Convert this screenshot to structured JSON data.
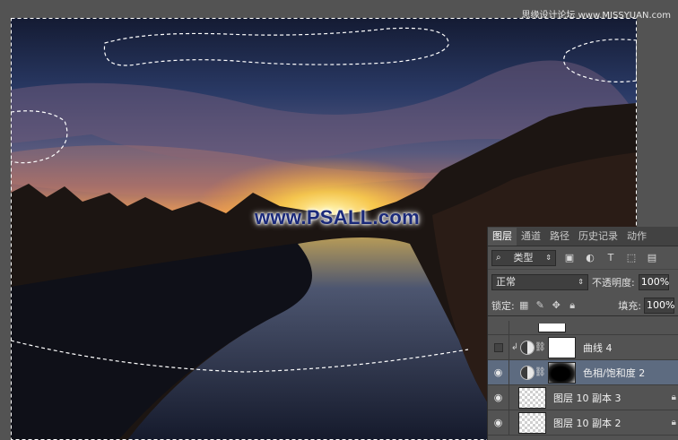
{
  "watermark": "思缘设计论坛 www.MISSYUAN.com",
  "canvas": {
    "site_label": "www.PSALL.com"
  },
  "panel": {
    "tabs": [
      "图层",
      "通道",
      "路径",
      "历史记录",
      "动作"
    ],
    "filter": {
      "kind": "类型",
      "icons": [
        "image-filter-icon",
        "adjustment-filter-icon",
        "type-filter-icon",
        "shape-filter-icon",
        "smart-object-filter-icon"
      ],
      "type_glyph": "T"
    },
    "blend_mode": "正常",
    "opacity_label": "不透明度:",
    "opacity_value": "100%",
    "lock_label": "锁定:",
    "fill_label": "填充:",
    "fill_value": "100%",
    "layers": [
      {
        "name": "曲线 4",
        "visible": false,
        "type": "adjustment",
        "clipped": true
      },
      {
        "name": "色相/饱和度 2",
        "visible": true,
        "type": "adjustment",
        "selected": true
      },
      {
        "name": "图层 10 副本 3",
        "visible": true,
        "type": "pixel",
        "locked": true
      },
      {
        "name": "图层 10 副本 2",
        "visible": true,
        "type": "pixel",
        "locked": true
      }
    ]
  },
  "colors": {
    "panel_bg": "#535353",
    "selected_row": "#5d6b80",
    "site_label": "#1b2a7a"
  }
}
